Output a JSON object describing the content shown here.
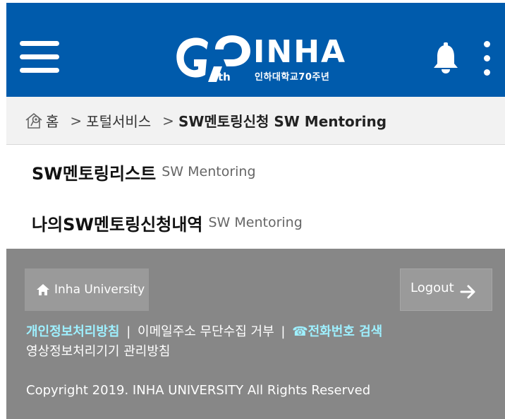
{
  "header": {
    "logo_main": "INHA",
    "logo_anniv": "인하대학교70주년",
    "logo_th": "th",
    "colors": {
      "header_bg": "#005bac",
      "footer_bg": "#878787",
      "footer_highlight": "#9ef0ff"
    },
    "icons": {
      "menu": "hamburger-icon",
      "notifications": "bell-icon",
      "more": "kebab-icon"
    }
  },
  "breadcrumb": {
    "home": "홈",
    "separator": ">",
    "level1": "포털서비스",
    "current": "SW멘토링신청 SW Mentoring"
  },
  "menu": {
    "items": [
      {
        "ko": "SW멘토링리스트",
        "en": "SW Mentoring"
      },
      {
        "ko": "나의SW멘토링신청내역",
        "en": "SW Mentoring"
      }
    ]
  },
  "footer": {
    "home_label": "Inha University",
    "logout_label": "Logout",
    "links": {
      "privacy": "개인정보처리방침",
      "sep1": "|",
      "email": "이메일주소 무단수집 거부",
      "sep2": "|",
      "phone_icon": "☎",
      "phone": "전화번호 검색",
      "cctv": "영상정보처리기기 관리방침"
    },
    "copyright": "Copyright 2019. INHA UNIVERSITY All Rights Reserved"
  }
}
